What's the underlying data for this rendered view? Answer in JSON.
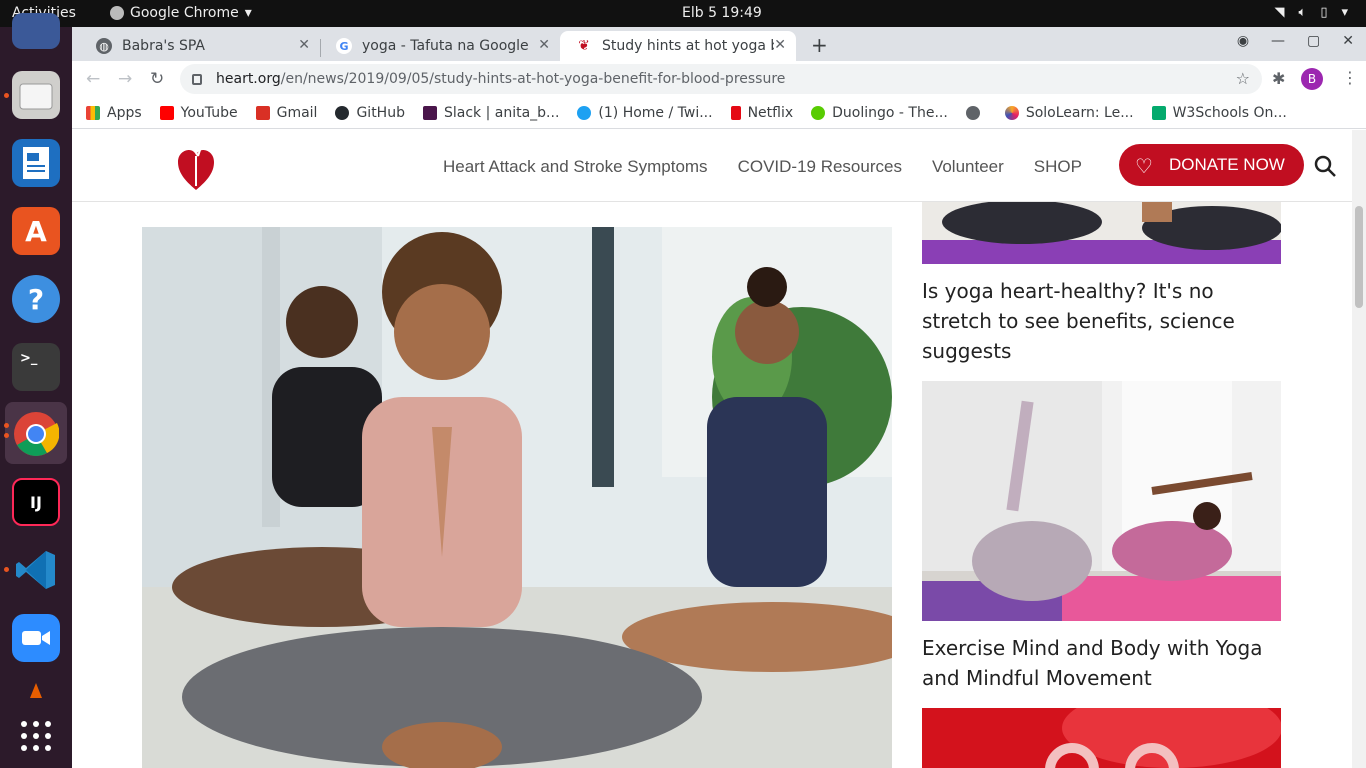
{
  "topbar": {
    "activities": "Activities",
    "app_name": "Google Chrome",
    "clock": "Elb 5  19:49"
  },
  "tabs": [
    {
      "title": "Babra's SPA"
    },
    {
      "title": "yoga - Tafuta na Google"
    },
    {
      "title": "Study hints at hot yoga be"
    }
  ],
  "omnibox": {
    "host": "heart.org",
    "path": "/en/news/2019/09/05/study-hints-at-hot-yoga-benefit-for-blood-pressure"
  },
  "profile_initial": "B",
  "bookmarks": [
    {
      "label": "Apps",
      "color": "#ea4335"
    },
    {
      "label": "YouTube",
      "color": "#ff0000"
    },
    {
      "label": "Gmail",
      "color": "#d93025"
    },
    {
      "label": "GitHub",
      "color": "#24292e"
    },
    {
      "label": "Slack | anita_b...",
      "color": "#4a154b"
    },
    {
      "label": "(1) Home / Twi...",
      "color": "#1da1f2"
    },
    {
      "label": "Netflix",
      "color": "#e50914"
    },
    {
      "label": "Duolingo - The...",
      "color": "#58cc02"
    },
    {
      "label": "",
      "color": "#5f6368"
    },
    {
      "label": "SoloLearn: Le...",
      "color": "#f9a825"
    },
    {
      "label": "W3Schools On...",
      "color": "#04aa6d"
    }
  ],
  "site": {
    "nav": [
      "Heart Attack and Stroke Symptoms",
      "COVID-19 Resources",
      "Volunteer",
      "SHOP"
    ],
    "donate": "DONATE NOW",
    "brand_color": "#c10e21"
  },
  "articles": [
    {
      "title": "Is yoga heart-healthy? It's no stretch to see benefits, science suggests"
    },
    {
      "title": "Exercise Mind and Body with Yoga and Mindful Movement"
    }
  ],
  "icons": {
    "dock": [
      "thunderbird-icon",
      "files-icon",
      "writer-icon",
      "software-icon",
      "help-icon",
      "terminal-icon",
      "chrome-icon",
      "intellij-icon",
      "vscode-icon",
      "zoom-icon",
      "vlc-icon",
      "app-grid-icon"
    ]
  }
}
